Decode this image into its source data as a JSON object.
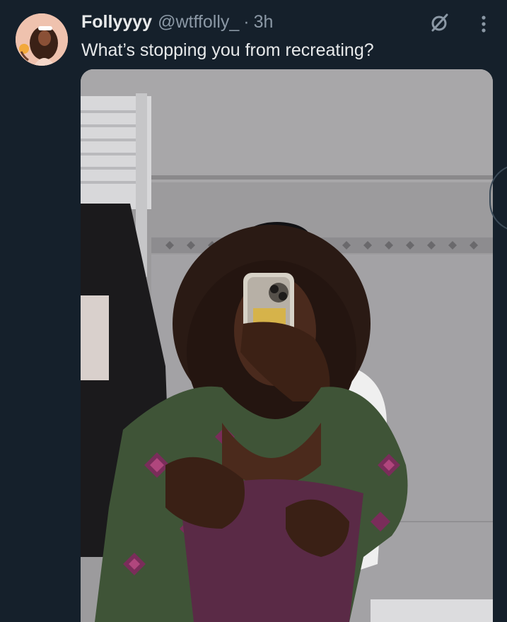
{
  "tweet": {
    "display_name": "Follyyyy",
    "handle": "@wtffolly_",
    "separator": "·",
    "time": "3h",
    "text": "What’s stopping you from recreating?"
  },
  "icons": {
    "grok": "grok-slash-icon",
    "more": "more-vertical-icon"
  },
  "colors": {
    "background": "#15202b",
    "primary_text": "#e7e9ea",
    "secondary_text": "#8b98a5"
  }
}
